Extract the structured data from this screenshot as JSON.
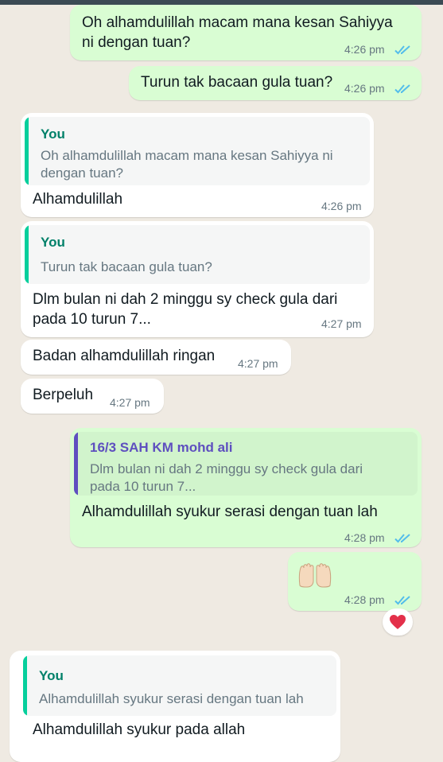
{
  "colors": {
    "outgoing_bubble": "#d9fdd3",
    "incoming_bubble": "#ffffff",
    "read_ticks": "#53bdeb",
    "quote_you": "#06cf9c",
    "quote_you_text": "#008069",
    "quote_other": "#5e4fbf",
    "heart": "#e3304a"
  },
  "messages": [
    {
      "text_line1": "Oh alhamdulillah macam mana kesan Sahiyya",
      "text_line2": "ni dengan tuan?",
      "time": "4:26 pm",
      "status": "read"
    },
    {
      "text": "Turun tak bacaan gula tuan?",
      "time": "4:26 pm",
      "status": "read"
    },
    {
      "quote_author": "You",
      "quote_line1": "Oh alhamdulillah macam mana kesan Sahiyya ni",
      "quote_line2": "dengan tuan?",
      "text": "Alhamdulillah",
      "time": "4:26 pm"
    },
    {
      "quote_author": "You",
      "quote_line1": "Turun tak bacaan gula tuan?",
      "text_line1": "Dlm bulan ni dah 2 minggu sy check gula dari",
      "text_line2": "pada 10 turun 7...",
      "time": "4:27 pm"
    },
    {
      "text": "Badan alhamdulillah ringan",
      "time": "4:27 pm"
    },
    {
      "text": "Berpeluh",
      "time": "4:27 pm"
    },
    {
      "quote_author": "16/3 SAH KM mohd ali",
      "quote_line1": "Dlm bulan ni dah 2 minggu sy check gula dari",
      "quote_line2": "pada 10 turun 7...",
      "text": "Alhamdulillah syukur serasi dengan tuan lah",
      "time": "4:28 pm",
      "status": "read"
    },
    {
      "emoji": "🙌🏻",
      "time": "4:28 pm",
      "status": "read",
      "reaction": "heart-icon"
    },
    {
      "quote_author": "You",
      "quote_line1": "Alhamdulillah syukur serasi dengan tuan lah",
      "text": "Alhamdulillah syukur pada allah"
    }
  ]
}
